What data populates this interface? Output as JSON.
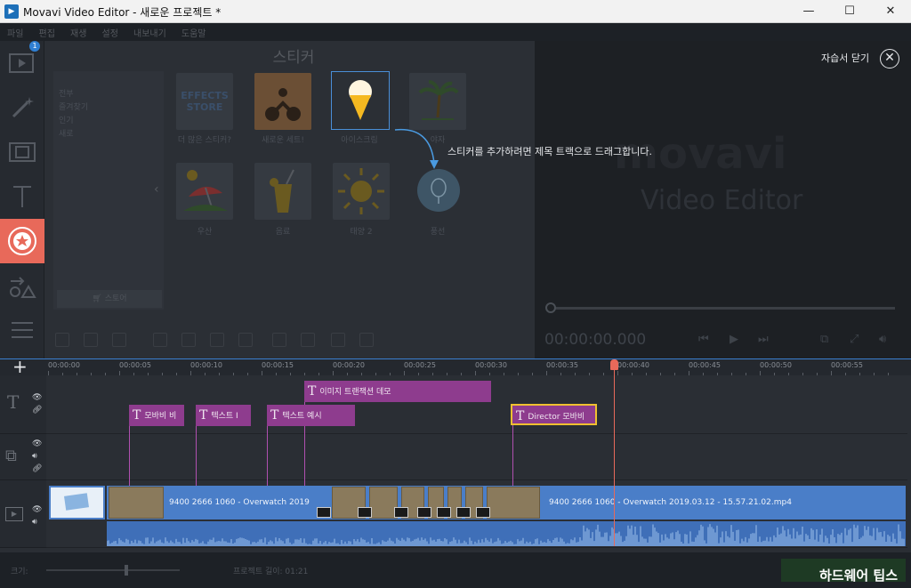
{
  "window": {
    "title": "Movavi Video Editor - 새로운 프로젝트 *",
    "min_label": "—",
    "max_label": "☐",
    "close_label": "✕"
  },
  "menu": [
    "파일",
    "편집",
    "재생",
    "설정",
    "내보내기",
    "도움말"
  ],
  "left_tools": {
    "badge": "1"
  },
  "panel": {
    "heading": "스티커",
    "categories": [
      "전부",
      "즐겨찾기",
      "인기",
      "새로"
    ],
    "store_label": "스토어",
    "tiles": [
      {
        "caption": "더 많은 스티커?",
        "art": "EFFECTS STORE"
      },
      {
        "caption": "새로운 세트!"
      },
      {
        "caption": "아이스크림"
      },
      {
        "caption": "야자"
      },
      {
        "caption": "우산"
      },
      {
        "caption": "음료"
      },
      {
        "caption": "태양 2"
      },
      {
        "caption": "풍선"
      }
    ]
  },
  "preview": {
    "logo_main": "movavi",
    "logo_sub": "Video Editor",
    "timecode": "00:00:00.000"
  },
  "tutorial": {
    "close_label": "자습서 닫기",
    "hint": "스티커를 추가하려면 제목 트랙으로 드래그합니다."
  },
  "ruler": [
    "00:00:00",
    "00:00:05",
    "00:00:10",
    "00:00:15",
    "00:00:20",
    "00:00:25",
    "00:00:30",
    "00:00:35",
    "00:00:40",
    "00:00:45",
    "00:00:50",
    "00:00:55"
  ],
  "title_clips": [
    {
      "label": "이미지 트랜잭션 데모"
    },
    {
      "label": "모바비 비"
    },
    {
      "label": "텍스트 I"
    },
    {
      "label": "텍스트 예시"
    },
    {
      "label": "Director 모바비"
    }
  ],
  "video": {
    "clip1_label": "9400 2666 1060 - Overwatch 2019",
    "clip2_label": "9400 2666 1060 - Overwatch 2019.03.12 - 15.57.21.02.mp4"
  },
  "bottom": {
    "scale_label": "크기:",
    "duration_label": "프로젝트 길이: 01:21"
  },
  "watermark": "하드웨어 팁스",
  "colors": {
    "accent": "#e8695a",
    "title_clip": "#8e3c8e",
    "video_clip": "#4a7ec8",
    "selection": "#4a8fd8"
  }
}
